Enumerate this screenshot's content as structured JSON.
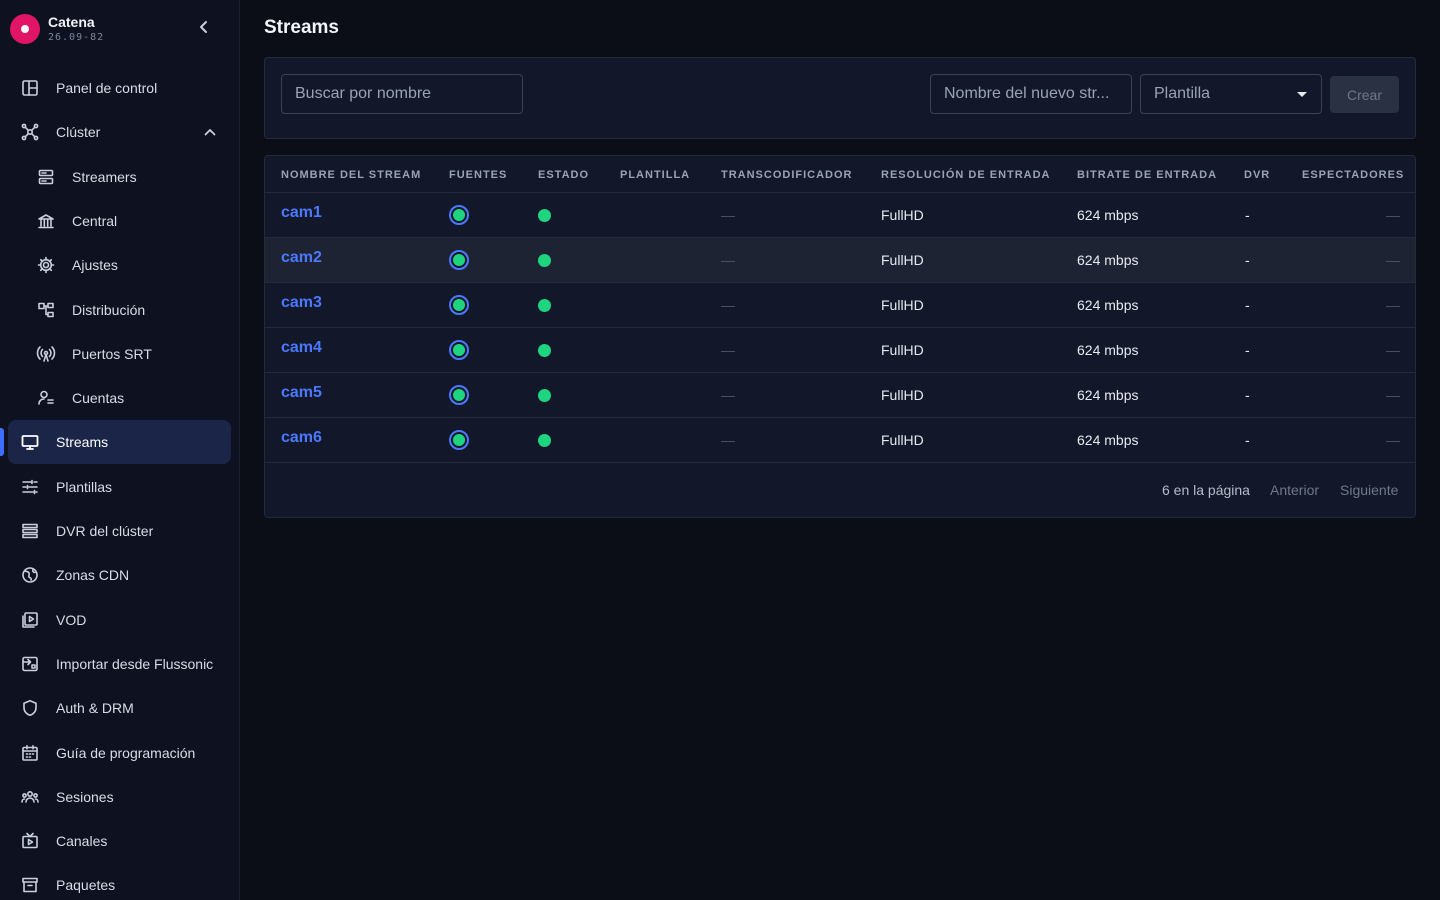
{
  "brand": {
    "name": "Catena",
    "version": "26.09-82",
    "accent": "#e01565"
  },
  "nav": [
    {
      "key": "panel",
      "label": "Panel de control",
      "icon": "dashboard-icon",
      "sub": false,
      "active": false
    },
    {
      "key": "cluster",
      "label": "Clúster",
      "icon": "cluster-icon",
      "sub": false,
      "active": false,
      "expanded": true
    },
    {
      "key": "streamers",
      "label": "Streamers",
      "icon": "server-icon",
      "sub": true,
      "active": false
    },
    {
      "key": "central",
      "label": "Central",
      "icon": "bank-icon",
      "sub": true,
      "active": false
    },
    {
      "key": "ajustes",
      "label": "Ajustes",
      "icon": "gear-icon",
      "sub": true,
      "active": false
    },
    {
      "key": "distribucion",
      "label": "Distribución",
      "icon": "distribution-icon",
      "sub": true,
      "active": false
    },
    {
      "key": "srt",
      "label": "Puertos SRT",
      "icon": "broadcast-icon",
      "sub": true,
      "active": false
    },
    {
      "key": "cuentas",
      "label": "Cuentas",
      "icon": "accounts-icon",
      "sub": true,
      "active": false
    },
    {
      "key": "streams",
      "label": "Streams",
      "icon": "monitor-icon",
      "sub": false,
      "active": true
    },
    {
      "key": "plantillas",
      "label": "Plantillas",
      "icon": "sliders-icon",
      "sub": false,
      "active": false
    },
    {
      "key": "dvr",
      "label": "DVR del clúster",
      "icon": "list-icon",
      "sub": false,
      "active": false
    },
    {
      "key": "cdn",
      "label": "Zonas CDN",
      "icon": "globe-icon",
      "sub": false,
      "active": false
    },
    {
      "key": "vod",
      "label": "VOD",
      "icon": "video-library-icon",
      "sub": false,
      "active": false
    },
    {
      "key": "import",
      "label": "Importar desde Flussonic",
      "icon": "import-icon",
      "sub": false,
      "active": false
    },
    {
      "key": "auth",
      "label": "Auth & DRM",
      "icon": "shield-icon",
      "sub": false,
      "active": false
    },
    {
      "key": "epg",
      "label": "Guía de programación",
      "icon": "calendar-icon",
      "sub": false,
      "active": false
    },
    {
      "key": "sesiones",
      "label": "Sesiones",
      "icon": "users-icon",
      "sub": false,
      "active": false
    },
    {
      "key": "canales",
      "label": "Canales",
      "icon": "tv-icon",
      "sub": false,
      "active": false
    },
    {
      "key": "paquetes",
      "label": "Paquetes",
      "icon": "archive-icon",
      "sub": false,
      "active": false
    }
  ],
  "page": {
    "title": "Streams"
  },
  "toolbar": {
    "search_placeholder": "Buscar por nombre",
    "new_name_placeholder": "Nombre del nuevo str...",
    "template_select": "Plantilla",
    "create_label": "Crear"
  },
  "table": {
    "columns": [
      "Nombre del stream",
      "Fuentes",
      "Estado",
      "Plantilla",
      "Transcodificador",
      "Resolución de entrada",
      "Bitrate de entrada",
      "DVR",
      "Espectadores"
    ],
    "rows": [
      {
        "name": "cam1",
        "template": "",
        "transcoder": "—",
        "resolution": "FullHD",
        "bitrate": "624 mbps",
        "dvr": "-",
        "viewers": "—"
      },
      {
        "name": "cam2",
        "template": "",
        "transcoder": "—",
        "resolution": "FullHD",
        "bitrate": "624 mbps",
        "dvr": "-",
        "viewers": "—"
      },
      {
        "name": "cam3",
        "template": "",
        "transcoder": "—",
        "resolution": "FullHD",
        "bitrate": "624 mbps",
        "dvr": "-",
        "viewers": "—"
      },
      {
        "name": "cam4",
        "template": "",
        "transcoder": "—",
        "resolution": "FullHD",
        "bitrate": "624 mbps",
        "dvr": "-",
        "viewers": "—"
      },
      {
        "name": "cam5",
        "template": "",
        "transcoder": "—",
        "resolution": "FullHD",
        "bitrate": "624 mbps",
        "dvr": "-",
        "viewers": "—"
      },
      {
        "name": "cam6",
        "template": "",
        "transcoder": "—",
        "resolution": "FullHD",
        "bitrate": "624 mbps",
        "dvr": "-",
        "viewers": "—"
      }
    ]
  },
  "pager": {
    "per_page": "6 en la página",
    "prev": "Anterior",
    "next": "Siguiente"
  },
  "colors": {
    "link": "#4a78ff",
    "status_ok": "#1ed47f",
    "active_bg": "#1b2547"
  }
}
